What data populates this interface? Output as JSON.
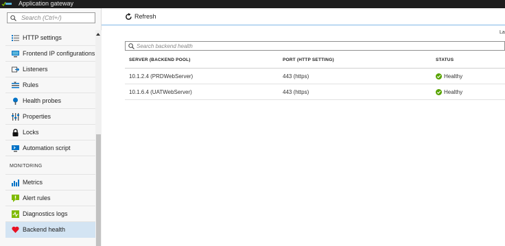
{
  "app": {
    "title": "Application gateway"
  },
  "sidebar": {
    "search_placeholder": "Search (Ctrl+/)",
    "items_top": [
      {
        "label": "HTTP settings",
        "icon": "list-icon"
      },
      {
        "label": "Frontend IP configurations",
        "icon": "monitor-icon"
      },
      {
        "label": "Listeners",
        "icon": "listener-icon"
      },
      {
        "label": "Rules",
        "icon": "rules-icon"
      },
      {
        "label": "Health probes",
        "icon": "probe-icon"
      },
      {
        "label": "Properties",
        "icon": "properties-icon"
      },
      {
        "label": "Locks",
        "icon": "lock-icon"
      },
      {
        "label": "Automation script",
        "icon": "automation-icon"
      }
    ],
    "section_monitoring": "MONITORING",
    "items_monitoring": [
      {
        "label": "Metrics",
        "icon": "metrics-icon"
      },
      {
        "label": "Alert rules",
        "icon": "alert-icon"
      },
      {
        "label": "Diagnostics logs",
        "icon": "diagnostics-icon"
      },
      {
        "label": "Backend health",
        "icon": "heart-icon",
        "active": true
      }
    ]
  },
  "toolbar": {
    "refresh_label": "Refresh"
  },
  "main": {
    "last_label": "La",
    "search_placeholder": "Search backend health",
    "columns": [
      "SERVER (BACKEND POOL)",
      "PORT (HTTP SETTING)",
      "STATUS"
    ],
    "rows": [
      {
        "server": "10.1.2.4 (PRDWebServer)",
        "port": "443 (https)",
        "status": "Healthy"
      },
      {
        "server": "10.1.6.4 (UATWebServer)",
        "port": "443 (https)",
        "status": "Healthy"
      }
    ]
  },
  "colors": {
    "accent": "#0072c6",
    "healthy": "#57a300",
    "heart": "#e81123",
    "active_bg": "#d3e4f3"
  }
}
